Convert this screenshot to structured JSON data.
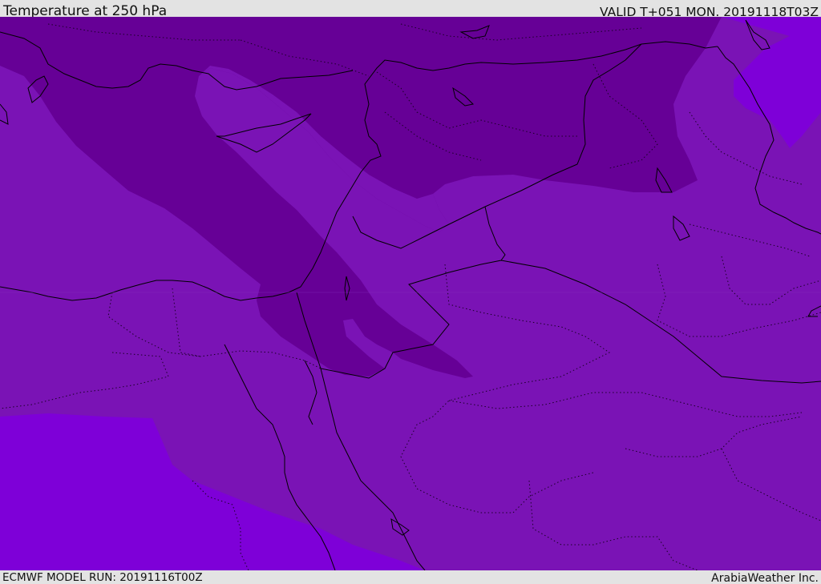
{
  "header": {
    "title": "Temperature at 250 hPa",
    "valid_time": "VALID T+051 MON. 20191118T03Z"
  },
  "footer": {
    "model_run": "ECMWF MODEL RUN: 20191116T00Z",
    "brand": "ArabiaWeather Inc."
  },
  "map": {
    "variable": "Temperature",
    "level": "250 hPa",
    "region": "Eastern Mediterranean / Middle East",
    "colors": {
      "background": "#7a13b5",
      "cold_band": "#660096",
      "warm_area": "#7e00d8",
      "border_line": "#000000",
      "footer_bar": "#e3e3e3"
    }
  }
}
